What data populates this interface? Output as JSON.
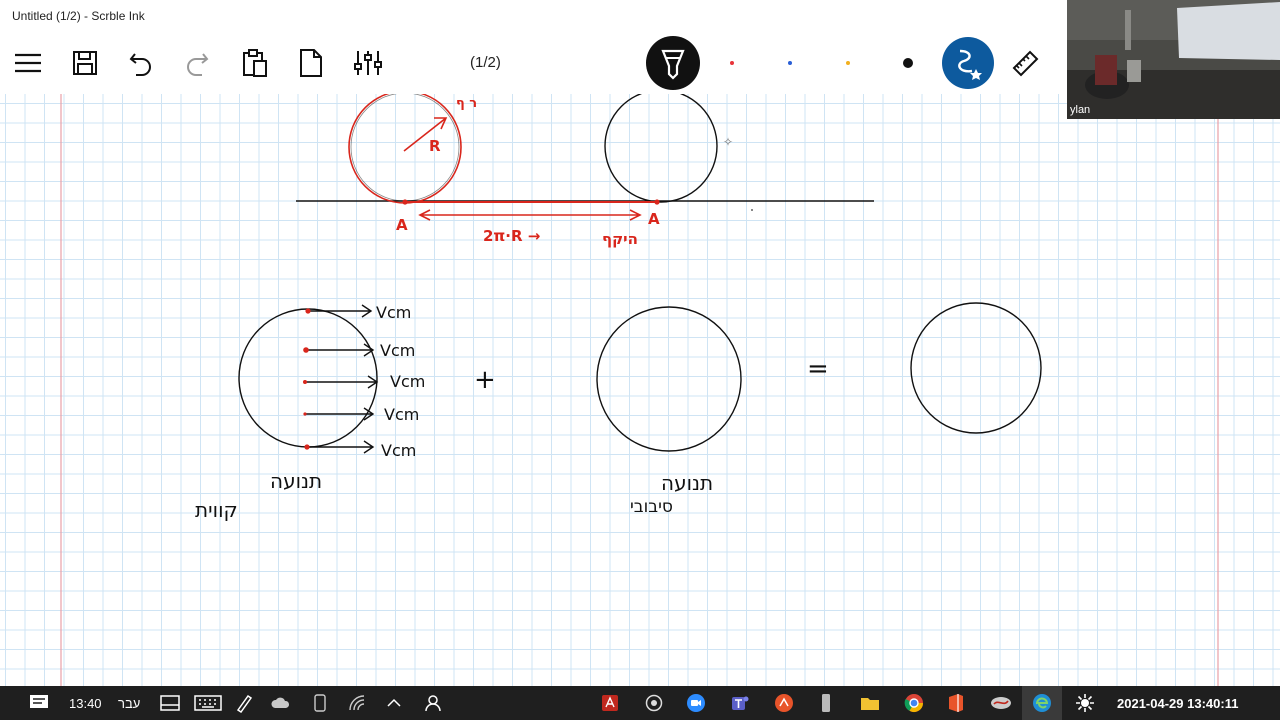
{
  "window": {
    "title": "Untitled (1/2) - Scrble Ink"
  },
  "toolbar": {
    "page_indicator": "(1/2)",
    "pen_colors": [
      "#e8343a",
      "#2a5fd6",
      "#f2b01e",
      "#111111"
    ],
    "accent": "#0d5a9e",
    "icons": [
      "menu-icon",
      "save-icon",
      "undo-icon",
      "redo-icon",
      "paste-icon",
      "new-page-icon",
      "settings-icon",
      "pen-icon",
      "shape-icon",
      "ruler-icon"
    ]
  },
  "video": {
    "participant": "ylan"
  },
  "canvas": {
    "labels": {
      "R": "R",
      "A_left": "A",
      "A_right": "A",
      "distance": "2π·R →",
      "vcm": "Vcm",
      "plus": "+",
      "equals": "=",
      "linear_motion_1": "תנועה",
      "linear_motion_2": "קווית",
      "rotational_motion_1": "תנועה",
      "rotational_motion_2": "סיבובי",
      "slip": "היקף",
      "top_note": "ר ף"
    }
  },
  "taskbar": {
    "time": "13:40",
    "language": "עבר",
    "datetime": "2021-04-29  13:40:11"
  }
}
